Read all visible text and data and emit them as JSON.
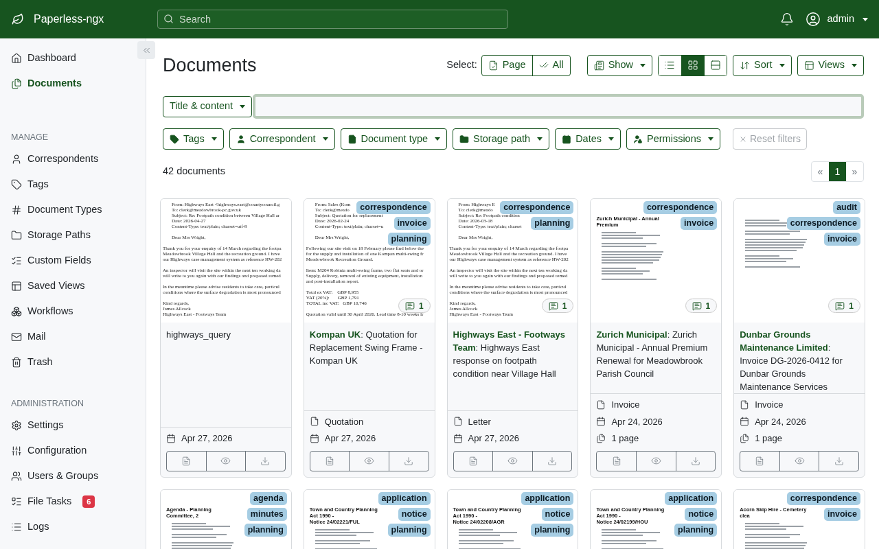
{
  "app": {
    "name": "Paperless-ngx",
    "search_placeholder": "Search",
    "user": "admin"
  },
  "sidebar": {
    "nav": [
      {
        "label": "Dashboard",
        "selected": false
      },
      {
        "label": "Documents",
        "selected": true
      }
    ],
    "sections": [
      {
        "heading": "MANAGE",
        "items": [
          {
            "label": "Correspondents",
            "selected": false
          },
          {
            "label": "Tags",
            "selected": false
          },
          {
            "label": "Document Types",
            "selected": false
          },
          {
            "label": "Storage Paths",
            "selected": false
          },
          {
            "label": "Custom Fields",
            "selected": false
          },
          {
            "label": "Saved Views",
            "selected": false
          },
          {
            "label": "Workflows",
            "selected": false
          },
          {
            "label": "Mail",
            "selected": false
          },
          {
            "label": "Trash",
            "selected": false
          }
        ]
      },
      {
        "heading": "ADMINISTRATION",
        "items": [
          {
            "label": "Settings",
            "selected": false
          },
          {
            "label": "Configuration",
            "selected": false
          },
          {
            "label": "Users & Groups",
            "selected": false
          },
          {
            "label": "File Tasks",
            "selected": false,
            "badge": "6"
          },
          {
            "label": "Logs",
            "selected": false
          }
        ]
      }
    ]
  },
  "page": {
    "title": "Documents",
    "select_label": "Select:",
    "select_buttons": [
      "Page",
      "All"
    ],
    "show": "Show",
    "views": [
      {
        "kind": "list",
        "selected": false
      },
      {
        "kind": "grid",
        "selected": true
      },
      {
        "kind": "details",
        "selected": false
      }
    ],
    "sort": "Sort",
    "saved_views": "Views"
  },
  "filter": {
    "field": "Title & content",
    "dropdowns": [
      "Tags",
      "Correspondent",
      "Document type",
      "Storage path",
      "Dates",
      "Permissions"
    ],
    "reset": {
      "label": "Reset filters",
      "disabled": true
    }
  },
  "count": "42 documents",
  "pagination": {
    "prev": "«",
    "pages": [
      {
        "label": "1",
        "selected": true
      }
    ],
    "next": "»"
  },
  "cards": [
    {
      "preview": {
        "kind": "email",
        "blocks": [
          {
            "indented": true,
            "lines": [
              "From: Highways East <highways.east@countycouncil.g",
              "To: clerk@meadowbrook-pc.gov.uk",
              "Subject: Re: Footpath condition between Village Hall ar",
              "Date: 2026-04-27",
              "Content-Type: text/plain; charset=utf-8"
            ]
          },
          {
            "indented": true,
            "lines": [
              "Dear Mrs Wright,"
            ]
          },
          {
            "indented": false,
            "lines": [
              "Thank you for your enquiry of 14 March regarding the footpa",
              "Meadowbrook Village Hall and the recreation ground. I have",
              "our Highways case management system as reference HW-202"
            ]
          },
          {
            "indented": false,
            "lines": [
              "An inspector will visit the site within the next ten working da",
              "will write to you again with our findings and proposed remed"
            ]
          },
          {
            "indented": false,
            "lines": [
              "In the meantime please advise residents to take care, particul",
              "conditions where the surface degradation is most pronounced"
            ]
          },
          {
            "indented": false,
            "lines": [
              "Kind regards,",
              "James Allcock",
              "Highways East - Footways Team"
            ]
          }
        ]
      },
      "title": "highways_query",
      "date": "Apr 27, 2026"
    },
    {
      "tags": [
        "correspondence",
        "invoice",
        "planning"
      ],
      "notes": "1",
      "preview": {
        "kind": "email",
        "blocks": [
          {
            "indented": true,
            "lines": [
              "From: Sales (Kom",
              "To: clerk@meado",
              "Subject: Quotation for replacement",
              "Date: 2026-02-24",
              "Content-Type: text/plain; charset=u"
            ]
          },
          {
            "indented": true,
            "lines": [
              "Dear Mrs Wright,"
            ]
          },
          {
            "indented": false,
            "lines": [
              "Following our site visit on 18 February please find below the",
              "for the supply and installation of one Kompan multi-swing fr",
              "Meadowbrook Recreation Ground."
            ]
          },
          {
            "indented": false,
            "lines": [
              "Item: M204 Robinia multi-swing frame, two flat seats and or",
              "Supply, delivery, removal of existing equipment, installation",
              "and post-installation report."
            ]
          },
          {
            "indented": false,
            "lines": [
              "Total ex VAT:    GBP 8,955",
              "VAT (20%):       GBP 1,791",
              "TOTAL inc VAT:   GBP 10,746"
            ]
          },
          {
            "indented": false,
            "lines": [
              "Quotation valid until 30 April 2026. Lead time 8-10 weeks fr"
            ]
          }
        ]
      },
      "title": "**Kompan UK**: Quotation for Replacement Swing Frame - Kompan UK",
      "doc_type": "Quotation",
      "date": "Apr 27, 2026"
    },
    {
      "tags": [
        "correspondence",
        "planning"
      ],
      "notes": "1",
      "preview": {
        "kind": "email",
        "blocks": [
          {
            "indented": true,
            "lines": [
              "From: Highways E",
              "To: clerk@meado",
              "Subject: Re: Footpath condition",
              "Date: 2026-03-18",
              "Content-Type: text/plain; charset"
            ]
          },
          {
            "indented": true,
            "lines": [
              "Dear Mrs Wright,"
            ]
          },
          {
            "indented": false,
            "lines": [
              "Thank you for your enquiry of 14 March regarding the footpa",
              "Meadowbrook Village Hall and the recreation ground. I have",
              "our Highways case management system as reference HW-202"
            ]
          },
          {
            "indented": false,
            "lines": [
              "An inspector will visit the site within the next ten working da",
              "will write to you again with our findings and proposed remed"
            ]
          },
          {
            "indented": false,
            "lines": [
              "In the meantime please advise residents to take care, particul",
              "conditions where the surface degradation is most pronounced"
            ]
          },
          {
            "indented": false,
            "lines": [
              "Kind regards,",
              "James Allcock",
              "Highways East - Footways Team"
            ]
          }
        ]
      },
      "title": "**Highways East - Footways Team**: Highways East response on footpath condition near Village Hall",
      "doc_type": "Letter",
      "date": "Apr 27, 2026"
    },
    {
      "tags": [
        "correspondence",
        "invoice"
      ],
      "notes": "1",
      "preview": {
        "kind": "document",
        "headings": [
          "Zurich Municipal - Annual Premium"
        ]
      },
      "title": "**Zurich Municipal**: Zurich Municipal - Annual Premium Renewal for Meadowbrook Parish Council",
      "doc_type": "Invoice",
      "date": "Apr 24, 2026",
      "pages": "1 page"
    },
    {
      "tags": [
        "audit",
        "correspondence",
        "invoice"
      ],
      "notes": "1",
      "preview": {
        "kind": "document"
      },
      "title": "**Dunbar Grounds Maintenance Limited**: Invoice DG-2026-0412 for Dunbar Grounds Maintenance Services",
      "doc_type": "Invoice",
      "date": "Apr 24, 2026",
      "pages": "1 page"
    },
    {
      "tags": [
        "agenda",
        "minutes",
        "planning"
      ],
      "preview": {
        "kind": "document",
        "headings": [
          "Agenda - Planning Committee, 2"
        ]
      }
    },
    {
      "tags": [
        "application",
        "notice",
        "planning"
      ],
      "preview": {
        "kind": "document",
        "headings": [
          "Town and Country Planning Act 1990 -",
          "Notice 24/02221/FUL"
        ]
      }
    },
    {
      "tags": [
        "application",
        "notice",
        "planning"
      ],
      "preview": {
        "kind": "document",
        "headings": [
          "Town and Country Planning Act 1990 -",
          "Notice 24/02208/AGR"
        ]
      }
    },
    {
      "tags": [
        "application",
        "notice",
        "planning"
      ],
      "preview": {
        "kind": "document",
        "headings": [
          "Town and Country Planning Act 1990 -",
          "Notice 24/02199/HOU"
        ]
      }
    },
    {
      "tags": [
        "correspondence",
        "invoice"
      ],
      "preview": {
        "kind": "document",
        "headings": [
          "Acorn Skip Hire - Cemetery clea"
        ]
      }
    }
  ]
}
